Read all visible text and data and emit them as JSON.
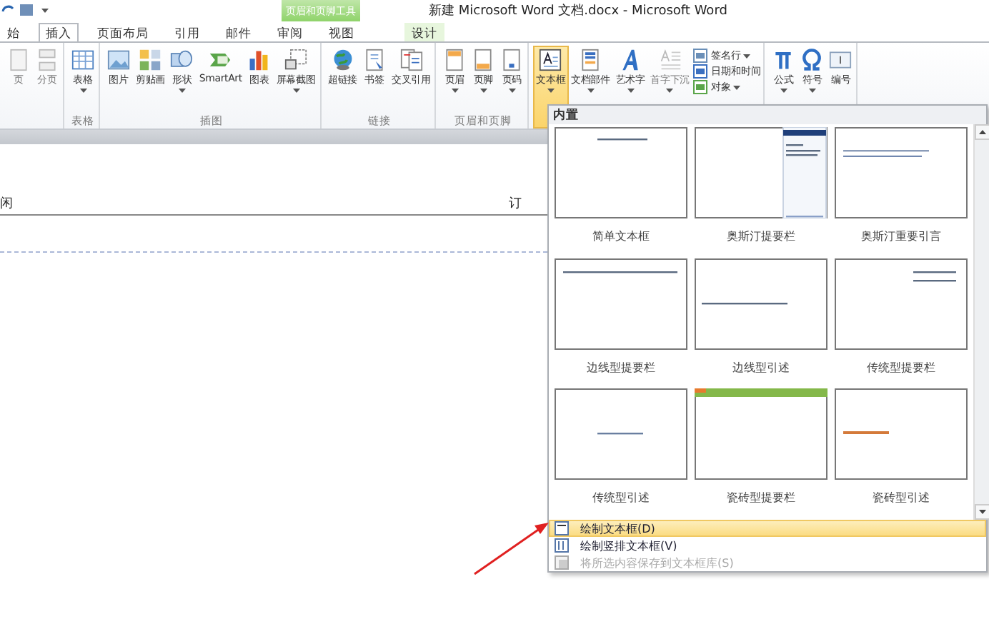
{
  "window": {
    "title": "新建 Microsoft Word 文档.docx - Microsoft Word"
  },
  "context_tab": {
    "header": "页眉和页脚工具"
  },
  "tabs": [
    {
      "label": "始",
      "selected": false
    },
    {
      "label": "插入",
      "selected": true
    },
    {
      "label": "页面布局",
      "selected": false
    },
    {
      "label": "引用",
      "selected": false
    },
    {
      "label": "邮件",
      "selected": false
    },
    {
      "label": "审阅",
      "selected": false
    },
    {
      "label": "视图",
      "selected": false
    },
    {
      "label": "设计",
      "selected": false,
      "kind": "context"
    }
  ],
  "ribbon_groups": [
    {
      "buttons": [
        {
          "kind": "page",
          "label": "页",
          "disabled": true,
          "selected": false,
          "dropdown": false
        },
        {
          "kind": "break",
          "label": "分页",
          "disabled": true,
          "selected": false,
          "dropdown": false
        }
      ]
    },
    {
      "label": "表格",
      "buttons": [
        {
          "kind": "table",
          "label": "表格",
          "disabled": false,
          "selected": false,
          "dropdown": true
        }
      ]
    },
    {
      "label": "插图",
      "buttons": [
        {
          "kind": "picture",
          "label": "图片",
          "disabled": false,
          "selected": false,
          "dropdown": false
        },
        {
          "kind": "clipart",
          "label": "剪贴画",
          "disabled": false,
          "selected": false,
          "dropdown": false
        },
        {
          "kind": "shapes",
          "label": "形状",
          "disabled": false,
          "selected": false,
          "dropdown": true
        },
        {
          "kind": "smartart",
          "label": "SmartArt",
          "disabled": false,
          "selected": false,
          "dropdown": false
        },
        {
          "kind": "chart",
          "label": "图表",
          "disabled": false,
          "selected": false,
          "dropdown": false
        },
        {
          "kind": "screenshot",
          "label": "屏幕截图",
          "disabled": false,
          "selected": false,
          "dropdown": true
        }
      ]
    },
    {
      "label": "链接",
      "buttons": [
        {
          "kind": "globe",
          "label": "超链接",
          "disabled": false,
          "selected": false,
          "dropdown": false
        },
        {
          "kind": "bookmark",
          "label": "书签",
          "disabled": false,
          "selected": false,
          "dropdown": false
        },
        {
          "kind": "crossref",
          "label": "交叉引用",
          "disabled": false,
          "selected": false,
          "dropdown": false
        }
      ]
    },
    {
      "label": "页眉和页脚",
      "buttons": [
        {
          "kind": "header",
          "label": "页眉",
          "disabled": false,
          "selected": false,
          "dropdown": true
        },
        {
          "kind": "footer",
          "label": "页脚",
          "disabled": false,
          "selected": false,
          "dropdown": true
        },
        {
          "kind": "pagenum",
          "label": "页码",
          "disabled": false,
          "selected": false,
          "dropdown": true
        }
      ]
    },
    {
      "buttons": [
        {
          "kind": "textbox",
          "label": "文本框",
          "disabled": false,
          "selected": true,
          "dropdown": true
        },
        {
          "kind": "parts",
          "label": "文档部件",
          "disabled": false,
          "selected": false,
          "dropdown": true
        },
        {
          "kind": "wordart",
          "label": "艺术字",
          "disabled": false,
          "selected": false,
          "dropdown": true
        },
        {
          "kind": "dropcap",
          "label": "首字下沉",
          "disabled": true,
          "selected": false,
          "dropdown": true
        },
        {
          "kind": "stack",
          "items": [
            {
              "label": "签名行",
              "dropdown": true
            },
            {
              "label": "日期和时间",
              "dropdown": false
            },
            {
              "label": "对象",
              "dropdown": true
            }
          ]
        }
      ]
    },
    {
      "buttons": [
        {
          "kind": "pi",
          "label": "公式",
          "disabled": false,
          "selected": false,
          "dropdown": true
        },
        {
          "kind": "omega",
          "label": "符号",
          "disabled": false,
          "selected": false,
          "dropdown": true
        },
        {
          "kind": "number",
          "label": "编号",
          "disabled": false,
          "selected": false,
          "dropdown": false
        }
      ]
    }
  ],
  "document": {
    "heading_fragment": "闲",
    "right_mark": "订"
  },
  "textbox_menu": {
    "section": "内置",
    "gallery": [
      {
        "caption": "简单文本框",
        "kind": "top-line"
      },
      {
        "caption": "奥斯汀提要栏",
        "kind": "sidebar"
      },
      {
        "caption": "奥斯汀重要引言",
        "kind": "quote-line"
      },
      {
        "caption": "边线型提要栏",
        "kind": "full-line"
      },
      {
        "caption": "边线型引述",
        "kind": "mid-line"
      },
      {
        "caption": "传统型提要栏",
        "kind": "right-lines"
      },
      {
        "caption": "传统型引述",
        "kind": "center-line"
      },
      {
        "caption": "瓷砖型提要栏",
        "kind": "banner"
      },
      {
        "caption": "瓷砖型引述",
        "kind": "orange-line"
      }
    ],
    "commands": [
      {
        "label": "绘制文本框(D)",
        "selected": true,
        "disabled": false,
        "kind": "draw"
      },
      {
        "label": "绘制竖排文本框(V)",
        "selected": false,
        "disabled": false,
        "kind": "vertical"
      },
      {
        "label": "将所选内容保存到文本框库(S)",
        "selected": false,
        "disabled": true,
        "kind": "save"
      }
    ]
  }
}
